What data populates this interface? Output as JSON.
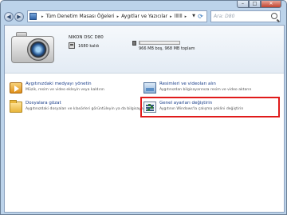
{
  "window": {
    "caption_buttons": {
      "minimize": "–",
      "maximize": "□",
      "close": "✕"
    }
  },
  "navbar": {
    "back_icon": "back-arrow-icon",
    "forward_icon": "forward-arrow-icon",
    "breadcrumb": [
      "Tüm Denetim Masası Öğeleri",
      "Aygıtlar ve Yazıcılar",
      "llllll"
    ],
    "separator": "▸",
    "dropdown": "▼",
    "refresh": "⟳",
    "search_placeholder": "Ara: D80"
  },
  "device": {
    "name": "NIKON DSC D80",
    "photos_left": "1680 kaldı",
    "storage_text": "966 MB boş, 968 MB toplam",
    "storage_used_fraction": 0.02
  },
  "tasks": [
    {
      "title": "Aygıtınızdaki medyayı yönetin",
      "desc": "Müzik, resim ve video ekleyin veya kaldırın",
      "icon": "media-player-icon"
    },
    {
      "title": "Resimleri ve videoları alın",
      "desc": "Aygıtınızdan bilgisayarınıza resim ve video aktarın",
      "icon": "import-pictures-icon"
    },
    {
      "title": "Dosyalara gözat",
      "desc": "Aygıtınızdaki dosyaları ve klasörleri görüntüleyin ya da bilgisayarınız...",
      "icon": "folder-icon"
    },
    {
      "title": "Genel ayarları değiştirin",
      "desc": "Aygıtının Windows'la çalışma şeklini değiştirin",
      "icon": "settings-list-icon"
    }
  ],
  "colors": {
    "highlight": "#e01b1b",
    "link": "#1a3e8a"
  }
}
